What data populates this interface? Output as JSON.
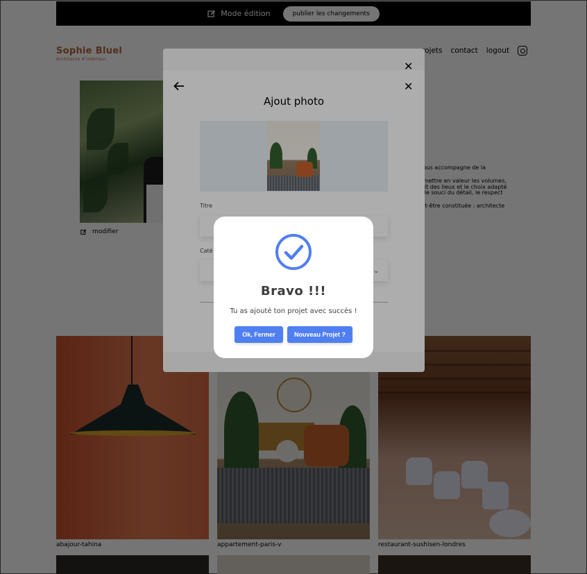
{
  "edit_bar": {
    "mode_label": "Mode édition",
    "publish_label": "publier les changements"
  },
  "header": {
    "logo_title": "Sophie Bluel",
    "logo_subtitle": "Architecte d'intérieur",
    "nav": [
      "projets",
      "contact",
      "logout"
    ]
  },
  "intro": {
    "modify_label": "modifier",
    "about_lines": [
      ". Je vous accompagne de la",
      "on à mettre en valeur les volumes,",
      "l'esprit des lieux et le choix adapté",
      "dans le souci du détail, le respect",
      "e peut-être constituée : architecte"
    ]
  },
  "gallery": [
    {
      "caption": "abajour-tahina"
    },
    {
      "caption": "appartement-paris-v"
    },
    {
      "caption": "restaurant-sushisen-londres"
    }
  ],
  "modal": {
    "title": "Ajout photo",
    "title_field_label": "Titre",
    "category_field_label": "Caté"
  },
  "dialog": {
    "title": "Bravo !!!",
    "message": "Tu as ajouté ton projet avec succès !",
    "ok_label": "Ok, Fermer",
    "new_label": "Nouveau Projet ?",
    "accent_color": "#4f7ff0"
  },
  "colors": {
    "brand": "#b1663c",
    "overlay": "rgba(0,0,0,0.32)"
  }
}
